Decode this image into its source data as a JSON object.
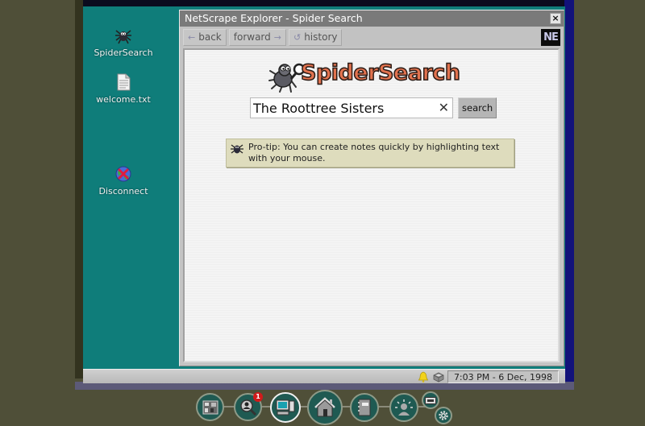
{
  "desktop": {
    "icons": [
      {
        "label": "SpiderSearch",
        "icon": "spider-icon"
      },
      {
        "label": "welcome.txt",
        "icon": "text-file-icon"
      },
      {
        "label": "Disconnect",
        "icon": "globe-disconnect-icon"
      }
    ]
  },
  "window": {
    "title": "NetScrape Explorer - Spider Search",
    "close_label": "×",
    "toolbar": {
      "back_label": "back",
      "forward_label": "forward",
      "history_label": "history",
      "back_arrow": "←",
      "forward_arrow": "→",
      "history_glyph": "↺",
      "brand_logo": "NE"
    }
  },
  "page": {
    "logo_text": "SpiderSearch",
    "search": {
      "value": "The Roottree Sisters",
      "placeholder": "",
      "clear_label": "✕",
      "button_label": "search"
    },
    "tip": {
      "text": "Pro-tip: You can create notes quickly by highlighting text with your mouse."
    }
  },
  "taskbar": {
    "clock": "7:03 PM - 6 Dec, 1998",
    "tray_icons": [
      "bell-icon",
      "network-box-icon"
    ]
  },
  "dock": {
    "items": [
      {
        "name": "evidence-board",
        "icon": "corkboard-icon"
      },
      {
        "name": "suspect-search",
        "icon": "magnifier-person-icon",
        "badge": "1"
      },
      {
        "name": "computer",
        "icon": "computer-icon",
        "active": true
      },
      {
        "name": "home",
        "icon": "house-icon"
      },
      {
        "name": "notebook",
        "icon": "notebook-icon"
      },
      {
        "name": "contact",
        "icon": "person-glow-icon"
      },
      {
        "name": "quick-save",
        "icon": "tape-icon"
      },
      {
        "name": "settings",
        "icon": "gear-icon"
      }
    ]
  },
  "colors": {
    "desktop_bg": "#0f7d7a",
    "room_bg": "#4f4f38",
    "logo_orange": "#e2734f",
    "tip_bg": "#dedcbd",
    "badge_red": "#d21a1a"
  }
}
